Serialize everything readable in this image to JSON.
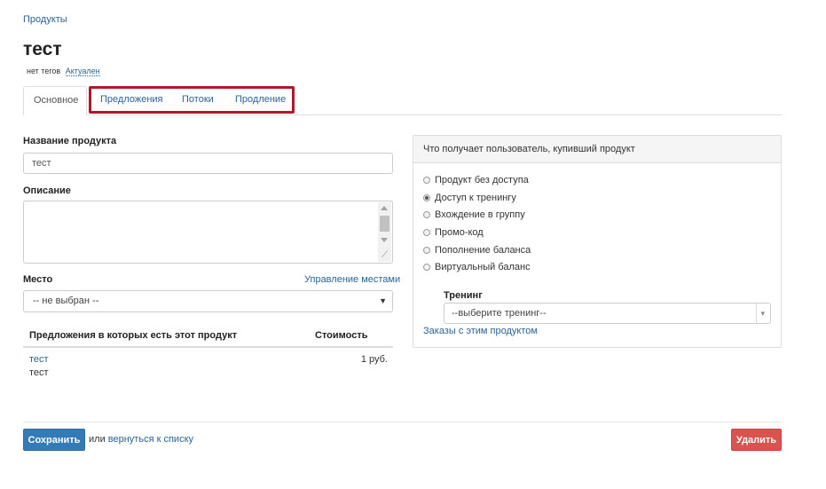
{
  "breadcrumb": "Продукты",
  "title": "тест",
  "meta": {
    "tags": "нет тегов",
    "status": "Актуален"
  },
  "tabs": [
    {
      "label": "Основное",
      "active": true
    },
    {
      "label": "Предложения",
      "active": false
    },
    {
      "label": "Потоки",
      "active": false
    },
    {
      "label": "Продление",
      "active": false
    }
  ],
  "form": {
    "name_label": "Название продукта",
    "name_value": "тест",
    "description_label": "Описание",
    "description_value": "",
    "place_label": "Место",
    "place_manage_link": "Управление местами",
    "place_selected": "-- не выбран --"
  },
  "offers_table": {
    "headers": [
      "Предложения в которых есть этот продукт",
      "Стоимость"
    ],
    "rows": [
      {
        "name": "тест",
        "subtitle": "тест",
        "price": "1 руб."
      }
    ]
  },
  "panel": {
    "title": "Что получает пользователь, купивший продукт",
    "options": [
      {
        "label": "Продукт без доступа",
        "checked": false
      },
      {
        "label": "Доступ к тренингу",
        "checked": true
      },
      {
        "label": "Вхождение в группу",
        "checked": false
      },
      {
        "label": "Промо-код",
        "checked": false
      },
      {
        "label": "Пополнение баланса",
        "checked": false
      },
      {
        "label": "Виртуальный баланс",
        "checked": false
      }
    ],
    "training_label": "Тренинг",
    "training_selected": "--выберите тренинг--",
    "orders_link": "Заказы с этим продуктом"
  },
  "footer": {
    "save_label": "Сохранить",
    "or_text": "или",
    "back_link": "вернуться к списку",
    "delete_label": "Удалить"
  },
  "colors": {
    "primary": "#337ab7",
    "danger": "#d9534f",
    "highlight": "#b0172b",
    "link": "#2a6496"
  }
}
